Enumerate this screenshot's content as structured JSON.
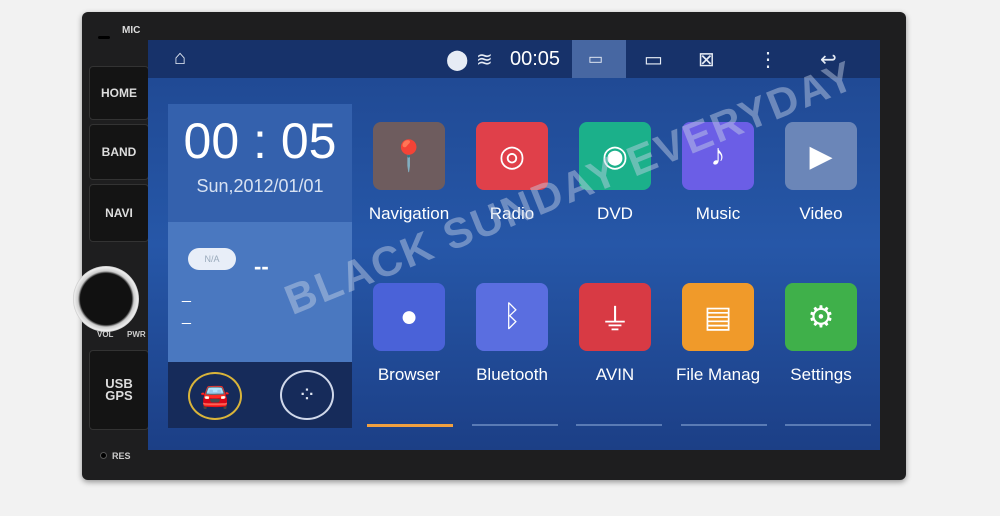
{
  "device": {
    "mic_label": "MIC",
    "buttons": [
      "HOME",
      "BAND",
      "NAVI"
    ],
    "vol_label": "VOL",
    "pwr_label": "PWR",
    "usb_label": "USB",
    "gps_label": "GPS",
    "res_label": "RES"
  },
  "status_bar": {
    "time": "00:05",
    "icons": [
      "home-icon",
      "location-icon",
      "wifi-icon",
      "screenshot-icon",
      "recent-apps-icon",
      "close-screen-icon",
      "more-icon",
      "back-icon"
    ]
  },
  "widget": {
    "clock": "00 : 05",
    "date": "Sun,2012/01/01",
    "weather_badge": "N/A",
    "temperature": "--",
    "line1": "_",
    "line2": "_"
  },
  "apps": [
    {
      "label": "Navigation",
      "color": "#6e5c5e",
      "icon": "map-pin-icon"
    },
    {
      "label": "Radio",
      "color": "#e0404a",
      "icon": "radio-icon"
    },
    {
      "label": "DVD",
      "color": "#1bb08a",
      "icon": "disc-icon"
    },
    {
      "label": "Music",
      "color": "#6b5ee6",
      "icon": "music-note-icon"
    },
    {
      "label": "Video",
      "color": "#6b86b8",
      "icon": "play-icon"
    },
    {
      "label": "Browser",
      "color": "#4a62d8",
      "icon": "globe-icon"
    },
    {
      "label": "Bluetooth",
      "color": "#5a6ee0",
      "icon": "bluetooth-icon"
    },
    {
      "label": "AVIN",
      "color": "#d83a44",
      "icon": "avin-icon"
    },
    {
      "label": "File Manag",
      "color": "#f09a2a",
      "icon": "folder-icon"
    },
    {
      "label": "Settings",
      "color": "#3fb04a",
      "icon": "gear-icon"
    }
  ],
  "pages": {
    "count": 5,
    "active": 0,
    "active_color": "#f0a040"
  },
  "watermark": "BLACK SUNDAY EVERYDAY"
}
